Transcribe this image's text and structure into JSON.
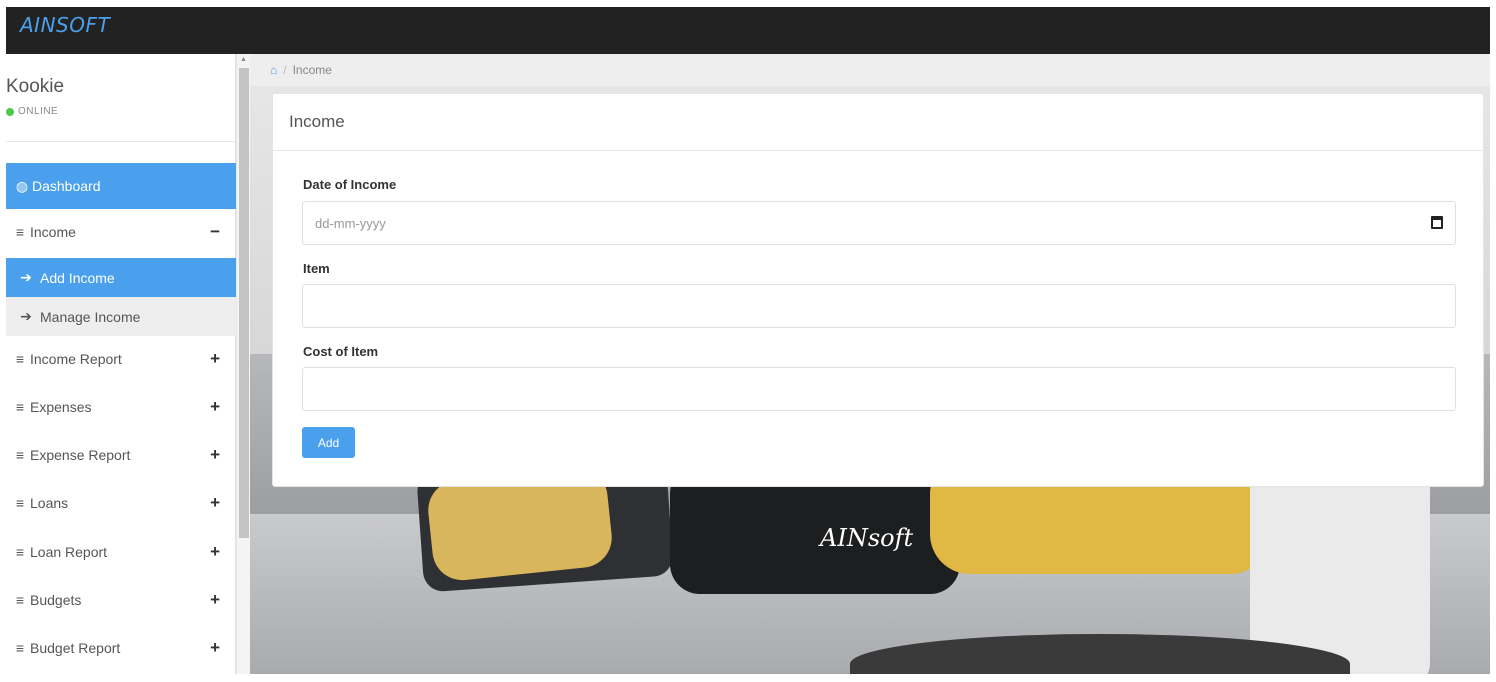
{
  "app": {
    "brand": "AINSOFT"
  },
  "user": {
    "name": "Kookie",
    "status": "ONLINE"
  },
  "sidebar": {
    "items": [
      {
        "label": "Dashboard",
        "icon": "dashboard-icon"
      },
      {
        "label": "Income",
        "toggle": "−"
      },
      {
        "label": "Add Income",
        "icon": "arrow-right-icon"
      },
      {
        "label": "Manage Income",
        "icon": "arrow-right-icon"
      },
      {
        "label": "Income Report",
        "toggle": "+"
      },
      {
        "label": "Expenses",
        "toggle": "+"
      },
      {
        "label": "Expense Report",
        "toggle": "+"
      },
      {
        "label": "Loans",
        "toggle": "+"
      },
      {
        "label": "Loan Report",
        "toggle": "+"
      },
      {
        "label": "Budgets",
        "toggle": "+"
      },
      {
        "label": "Budget Report",
        "toggle": "+"
      }
    ],
    "menu_glyph": "≡",
    "arrow_glyph": "➔"
  },
  "breadcrumb": {
    "current": "Income",
    "separator": "/"
  },
  "form": {
    "title": "Income",
    "date_label": "Date of Income",
    "date_placeholder": "dd-mm-yyyy",
    "item_label": "Item",
    "item_value": "",
    "cost_label": "Cost of Item",
    "cost_value": "",
    "submit_label": "Add"
  },
  "background": {
    "watermark": "AINsoft"
  },
  "colors": {
    "accent": "#4aa0ec",
    "topbar": "#222222",
    "online": "#4cc84c"
  }
}
